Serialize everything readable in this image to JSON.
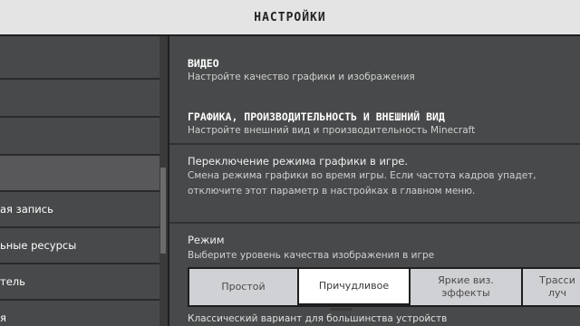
{
  "header": {
    "title": "НАСТРОЙКИ"
  },
  "sidebar": {
    "items": [
      {
        "label": ""
      },
      {
        "label": ""
      },
      {
        "label": ""
      },
      {
        "label": ""
      },
      {
        "label": "ая запись"
      },
      {
        "label": "ьные ресурсы"
      },
      {
        "label": "тель"
      },
      {
        "label": "я"
      }
    ]
  },
  "main": {
    "video": {
      "title": "ВИДЕО",
      "description": "Настройте качество графики и изображения"
    },
    "graphics": {
      "title": "ГРАФИКА, ПРОИЗВОДИТЕЛЬНОСТЬ И ВНЕШНИЙ ВИД",
      "description": "Настройте внешний вид и производительность Minecraft"
    },
    "ingame_switch": {
      "title": "Переключение режима графики в игре.",
      "description": "Смена режима графики во время игры. Если частота кадров упадет, отключите этот параметр в настройках в главном меню."
    },
    "mode": {
      "title": "Режим",
      "description": "Выберите уровень качества изображения в игре",
      "options": [
        "Простой",
        "Причудливое",
        "Яркие виз. эффекты",
        "Трасси луч"
      ],
      "selected": "Причудливое",
      "selected_description": "Классический вариант для большинства устройств"
    }
  }
}
